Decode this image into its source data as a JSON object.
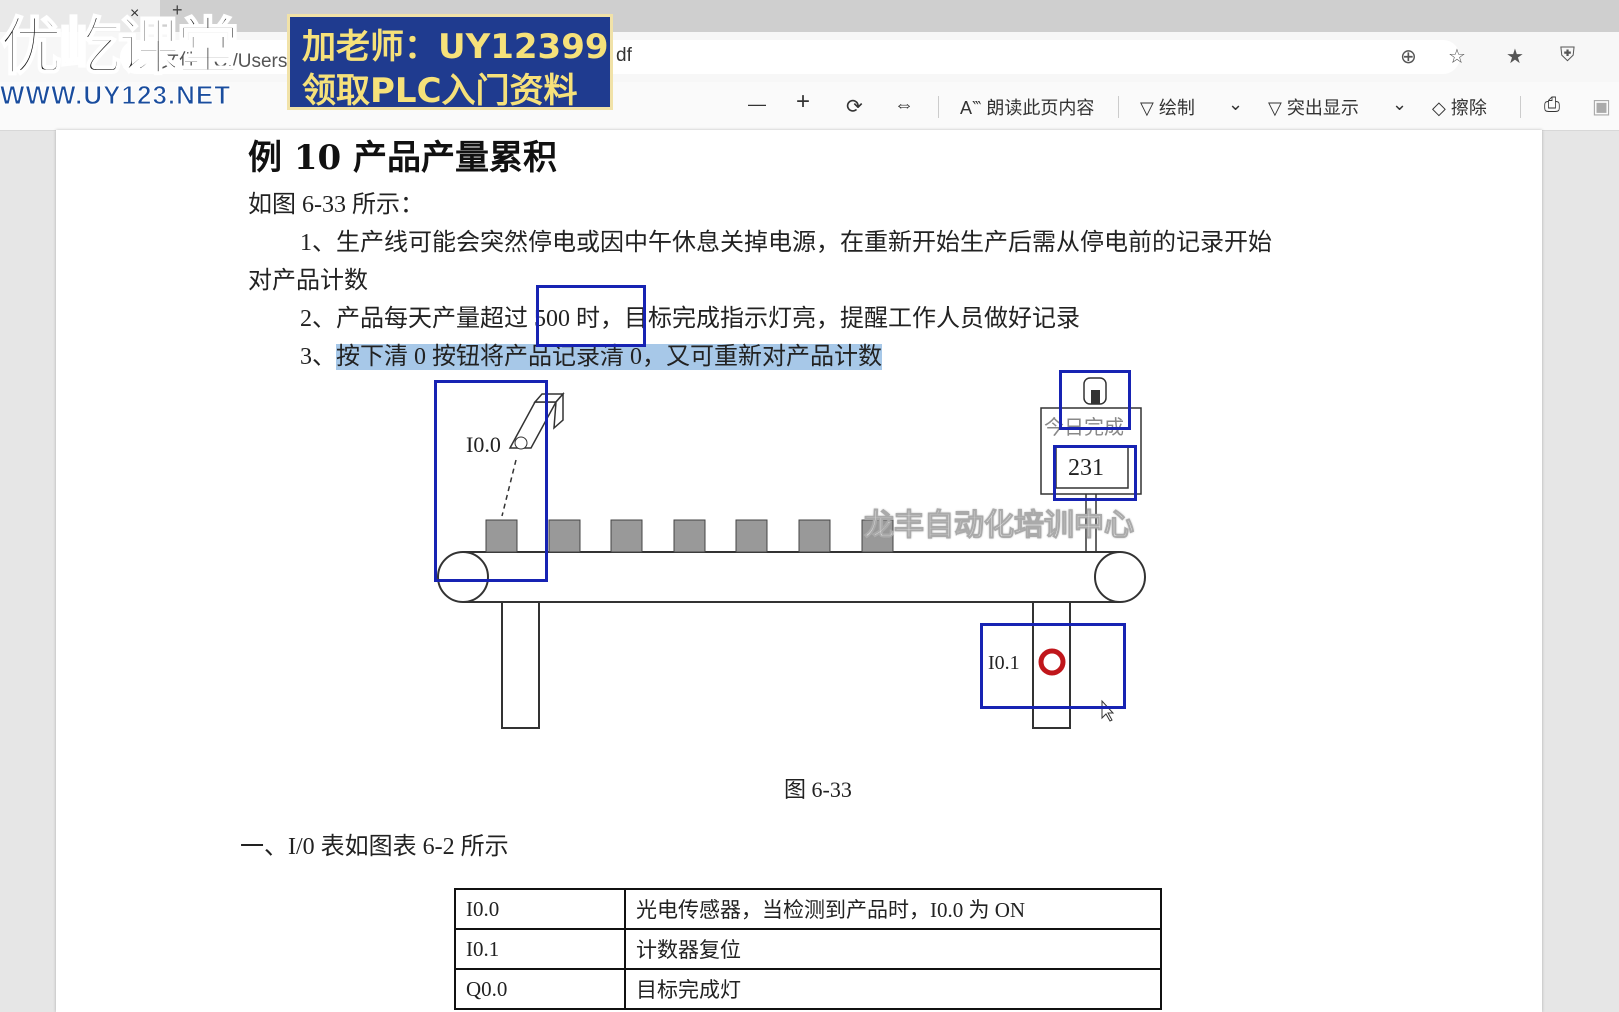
{
  "browser": {
    "tab_close": "×",
    "new_tab": "+",
    "url_partial": "文件 | C:/Users/0135/",
    "url_ext": "df"
  },
  "pdf_toolbar": {
    "zoom_out": "—",
    "zoom_in": "+",
    "read_aloud": "朗读此页内容",
    "draw": "绘制",
    "highlight": "突出显示",
    "erase": "擦除"
  },
  "overlay": {
    "logo_text": "优屹课堂",
    "logo_url": "WWW.UY123.NET",
    "ad_line1": "加老师：UY12399",
    "ad_line2": "领取PLC入门资料"
  },
  "document": {
    "title": "例 10  产品产量累积",
    "intro": "如图 6-33 所示：",
    "item1_a": "1、生产线可能会突然停电或因中午休息关掉电源，在重新开始生产后需从停电前的记录开始",
    "item1_b": "对产品计数",
    "item2": "2、产品每天产量超过 500 时，目标完成指示灯亮，提醒工作人员做好记录",
    "item3_num": "3、",
    "item3_text": "按下清 0 按钮将产品记录清 0，又可重新对产品计数",
    "figure": {
      "sensor_label": "I0.0",
      "reset_label": "I0.1",
      "display_title": "今日完成",
      "display_value": "231",
      "watermark": "龙丰自动化培训中心",
      "caption": "图 6-33"
    },
    "io_heading": "一、I/0 表如图表 6-2 所示",
    "io_table": [
      {
        "addr": "I0.0",
        "desc": "光电传感器，当检测到产品时，I0.0 为 ON"
      },
      {
        "addr": "I0.1",
        "desc": "计数器复位"
      },
      {
        "addr": "Q0.0",
        "desc": "目标完成灯"
      }
    ]
  },
  "colors": {
    "annotation_box": "#1723b3",
    "highlight": "#a7c8e8",
    "button_red": "#c0161b"
  }
}
